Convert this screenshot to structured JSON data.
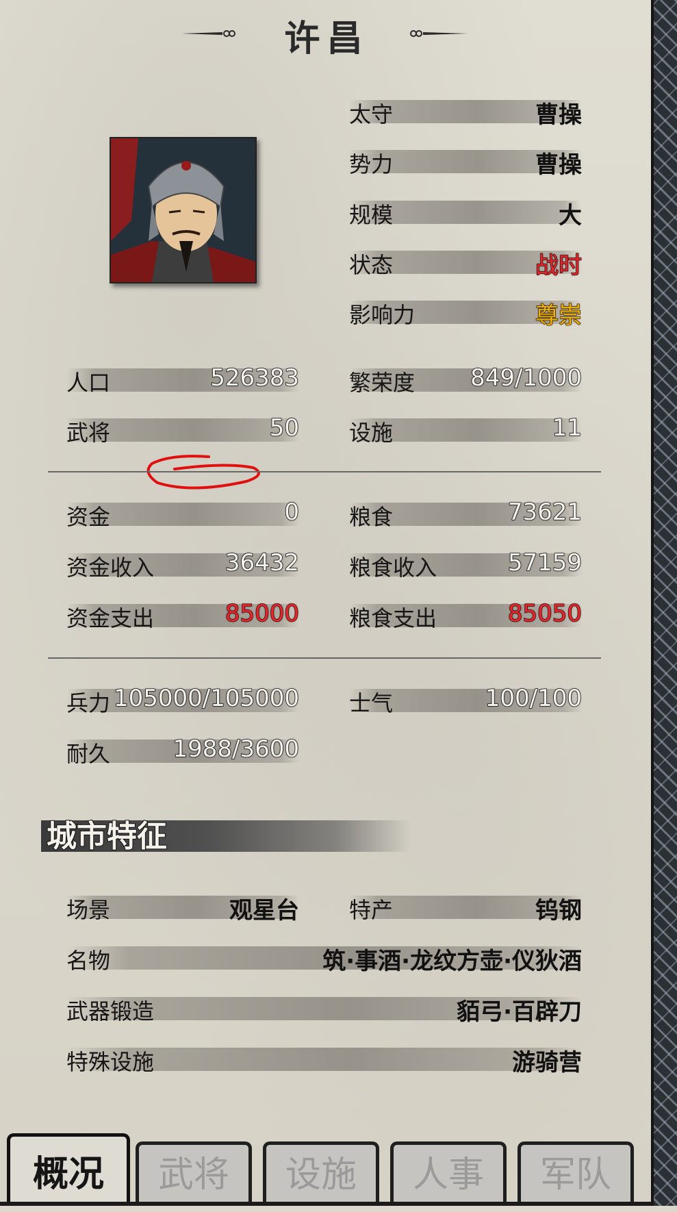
{
  "city_name": "许昌",
  "info": {
    "governor": {
      "label": "太守",
      "value": "曹操"
    },
    "faction": {
      "label": "势力",
      "value": "曹操"
    },
    "scale": {
      "label": "规模",
      "value": "大"
    },
    "status": {
      "label": "状态",
      "value": "战时"
    },
    "influence": {
      "label": "影响力",
      "value": "尊崇"
    }
  },
  "stats": {
    "population": {
      "label": "人口",
      "value": "526383"
    },
    "prosperity": {
      "label": "繁荣度",
      "value": "849/1000"
    },
    "generals": {
      "label": "武将",
      "value": "50"
    },
    "facilities": {
      "label": "设施",
      "value": "11"
    }
  },
  "economy": {
    "funds": {
      "label": "资金",
      "value": "0"
    },
    "food": {
      "label": "粮食",
      "value": "73621"
    },
    "funds_income": {
      "label": "资金收入",
      "value": "36432"
    },
    "food_income": {
      "label": "粮食收入",
      "value": "57159"
    },
    "funds_expense": {
      "label": "资金支出",
      "value": "85000"
    },
    "food_expense": {
      "label": "粮食支出",
      "value": "85050"
    }
  },
  "military": {
    "troops": {
      "label": "兵力",
      "value": "105000/105000"
    },
    "morale": {
      "label": "士气",
      "value": "100/100"
    },
    "durability": {
      "label": "耐久",
      "value": "1988/3600"
    }
  },
  "features": {
    "title": "城市特征",
    "scene": {
      "label": "场景",
      "value": "观星台"
    },
    "specialty": {
      "label": "特产",
      "value": "钨钢"
    },
    "famous_items": {
      "label": "名物",
      "value": "筑·事酒·龙纹方壶·仪狄酒"
    },
    "weapon_forging": {
      "label": "武器锻造",
      "value": "貊弓·百辟刀"
    },
    "special_facility": {
      "label": "特殊设施",
      "value": "游骑营"
    }
  },
  "tabs": [
    "概况",
    "武将",
    "设施",
    "人事",
    "军队"
  ],
  "active_tab": "概况",
  "colors": {
    "warning_red": "#e8262c",
    "influence_gold": "#f2b100"
  }
}
